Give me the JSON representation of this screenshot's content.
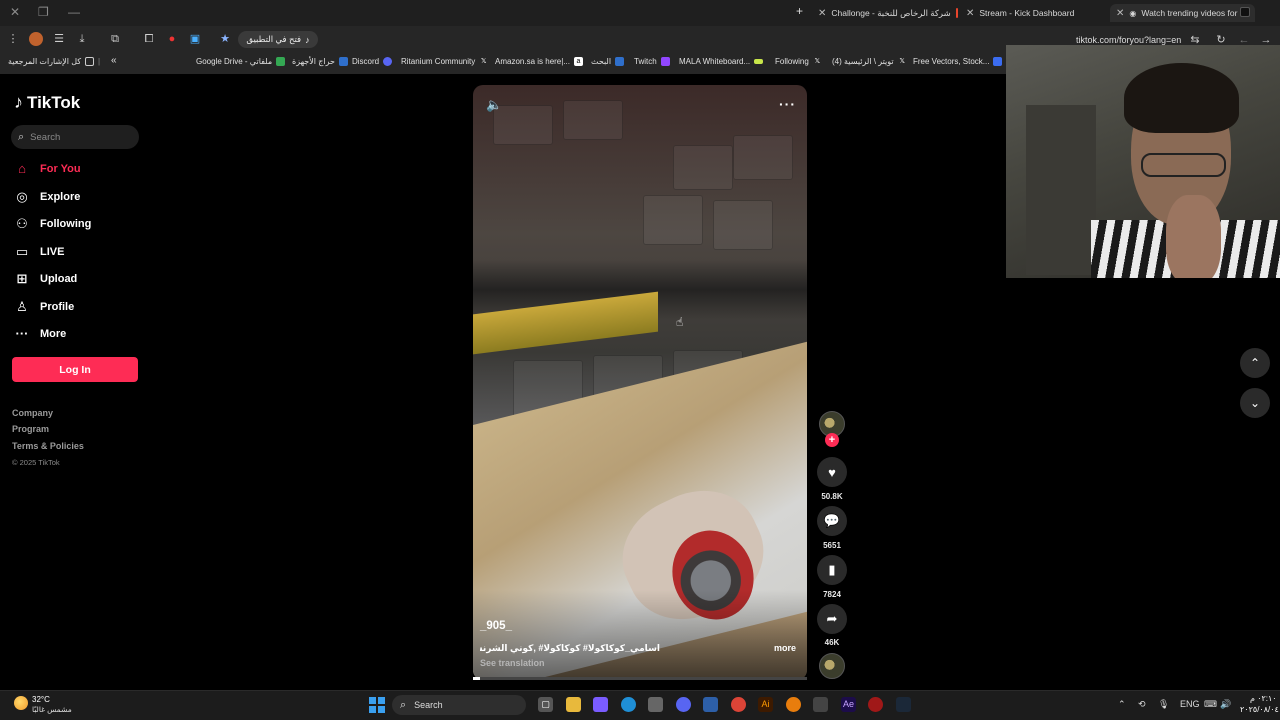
{
  "browser": {
    "tabs": [
      {
        "title": "Challonge - شركة الرخاص للنخبة",
        "favicon_color": "#e8452c"
      },
      {
        "title": "Stream - Kick Dashboard",
        "favicon_color": "#53fc18"
      },
      {
        "title": "Watch trending videos for",
        "favicon_color": "#ffffff"
      }
    ],
    "new_tab_label": "+",
    "omnibox_label": "فتح في التطبيق",
    "url": "tiktok.com/foryou?lang=en",
    "bookmarks": [
      {
        "label": "كل الإشارات المرجعية",
        "icon": "folder-icon"
      },
      {
        "label": "Google Drive - ملفاتي",
        "icon": "drive-icon"
      },
      {
        "label": "حراج الأجهزة",
        "icon": "haraj-icon"
      },
      {
        "label": "Discord",
        "icon": "discord-icon"
      },
      {
        "label": "Ritanium Community",
        "icon": "x-icon"
      },
      {
        "label": "Amazon.sa is here|...",
        "icon": "amazon-icon"
      },
      {
        "label": "البحث",
        "icon": "search-bm-icon"
      },
      {
        "label": "Twitch",
        "icon": "twitch-icon"
      },
      {
        "label": "MALA Whiteboard...",
        "icon": "whiteboard-icon"
      },
      {
        "label": "Following",
        "icon": "x-icon"
      },
      {
        "label": "(4) تويتر \\ الرئيسية",
        "icon": "x-icon"
      },
      {
        "label": "Free Vectors, Stock...",
        "icon": "freepik-icon"
      }
    ]
  },
  "sidebar": {
    "logo": "TikTok",
    "search_placeholder": "Search",
    "nav": [
      {
        "label": "For You",
        "icon": "home-icon",
        "active": true
      },
      {
        "label": "Explore",
        "icon": "compass-icon"
      },
      {
        "label": "Following",
        "icon": "following-icon"
      },
      {
        "label": "LIVE",
        "icon": "live-icon"
      },
      {
        "label": "Upload",
        "icon": "upload-icon"
      },
      {
        "label": "Profile",
        "icon": "profile-icon"
      },
      {
        "label": "More",
        "icon": "more-icon"
      }
    ],
    "login_label": "Log In",
    "footer": [
      "Company",
      "Program",
      "Terms & Policies"
    ],
    "copyright": "© 2025 TikTok"
  },
  "video": {
    "author": "_905_",
    "caption": "اسامي_كوكاكولا# كوكاكولا# ,كوني الشرنسي , ...",
    "more_label": "more",
    "see_translation": "See translation",
    "progress": 0.02,
    "likes": "50.8K",
    "comments": "5651",
    "saves": "7824",
    "shares": "46K"
  },
  "taskbar": {
    "temperature": "32°C",
    "weather": "مشمس غالبًا",
    "search_label": "Search",
    "language": "ENG",
    "time": "٠٢:١٠ م",
    "date": "٢٠٢٥/٠٨/٠٤"
  },
  "colors": {
    "accent": "#fe2c55",
    "background": "#000000"
  }
}
